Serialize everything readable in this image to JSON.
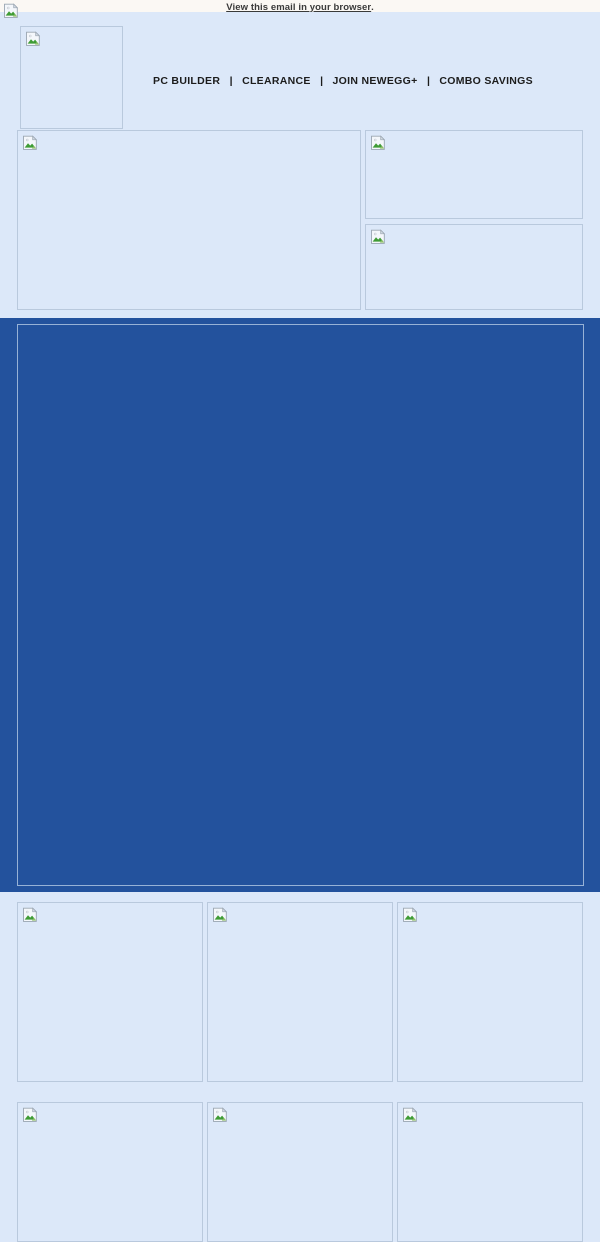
{
  "preheader": {
    "link_text": "View this email in your browser",
    "trailing": ".",
    "icon": "none"
  },
  "header": {
    "logo": {
      "alt": "newegg-logo",
      "icon": "broken-image-icon"
    },
    "nav": [
      {
        "label": "PC BUILDER",
        "name": "nav-pc-builder"
      },
      {
        "label": "CLEARANCE",
        "name": "nav-clearance"
      },
      {
        "label": "JOIN NEWEGG+",
        "name": "nav-join-newegg-plus"
      },
      {
        "label": "COMBO SAVINGS",
        "name": "nav-combo-savings"
      }
    ],
    "separator": "|"
  },
  "features": {
    "left": {
      "alt": "feature-main-banner",
      "icon": "broken-image-icon"
    },
    "right_top": {
      "alt": "feature-secondary-banner-top",
      "icon": "broken-image-icon"
    },
    "right_bottom": {
      "alt": "feature-secondary-banner-bottom",
      "icon": "broken-image-icon"
    }
  },
  "promo": {
    "alt": "main-promo-banner",
    "icon": "broken-image-icon"
  },
  "product_rows": [
    {
      "name": "product-row-1",
      "cards": [
        {
          "alt": "product-card-1",
          "icon": "broken-image-icon"
        },
        {
          "alt": "product-card-2",
          "icon": "broken-image-icon"
        },
        {
          "alt": "product-card-3",
          "icon": "broken-image-icon"
        }
      ]
    },
    {
      "name": "product-row-2",
      "cards": [
        {
          "alt": "product-card-4",
          "icon": "broken-image-icon"
        },
        {
          "alt": "product-card-5",
          "icon": "broken-image-icon"
        },
        {
          "alt": "product-card-6",
          "icon": "broken-image-icon"
        }
      ]
    }
  ],
  "colors": {
    "page_background": "#fbf8f4",
    "body_background": "#dce8f9",
    "promo_blue": "#23529d",
    "border": "#b9c9dd",
    "promo_border": "#97b2d6",
    "nav_text": "#1c1c1c",
    "preheader_text": "#3a3a3a"
  }
}
